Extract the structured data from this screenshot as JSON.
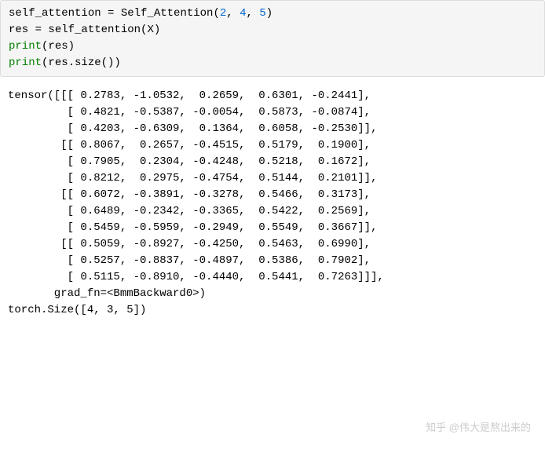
{
  "code": {
    "line1_parts": [
      {
        "c": "kw-black",
        "t": "self_attention "
      },
      {
        "c": "kw-black",
        "t": "= "
      },
      {
        "c": "kw-black",
        "t": "Self_Attention("
      },
      {
        "c": "num-blue",
        "t": "2"
      },
      {
        "c": "kw-black",
        "t": ", "
      },
      {
        "c": "num-blue",
        "t": "4"
      },
      {
        "c": "kw-black",
        "t": ", "
      },
      {
        "c": "num-blue",
        "t": "5"
      },
      {
        "c": "kw-black",
        "t": ")"
      }
    ],
    "line2_parts": [
      {
        "c": "kw-black",
        "t": "res "
      },
      {
        "c": "kw-black",
        "t": "= "
      },
      {
        "c": "kw-black",
        "t": "self_attention(X)"
      }
    ],
    "line3_parts": [
      {
        "c": "kw-green",
        "t": "print"
      },
      {
        "c": "kw-black",
        "t": "(res)"
      }
    ],
    "line4_parts": [
      {
        "c": "kw-green",
        "t": "print"
      },
      {
        "c": "kw-black",
        "t": "(res.size())"
      }
    ]
  },
  "output": [
    "tensor([[[ 0.2783, -1.0532,  0.2659,  0.6301, -0.2441],",
    "         [ 0.4821, -0.5387, -0.0054,  0.5873, -0.0874],",
    "         [ 0.4203, -0.6309,  0.1364,  0.6058, -0.2530]],",
    "",
    "        [[ 0.8067,  0.2657, -0.4515,  0.5179,  0.1900],",
    "         [ 0.7905,  0.2304, -0.4248,  0.5218,  0.1672],",
    "         [ 0.8212,  0.2975, -0.4754,  0.5144,  0.2101]],",
    "",
    "        [[ 0.6072, -0.3891, -0.3278,  0.5466,  0.3173],",
    "         [ 0.6489, -0.2342, -0.3365,  0.5422,  0.2569],",
    "         [ 0.5459, -0.5959, -0.2949,  0.5549,  0.3667]],",
    "",
    "        [[ 0.5059, -0.8927, -0.4250,  0.5463,  0.6990],",
    "         [ 0.5257, -0.8837, -0.4897,  0.5386,  0.7902],",
    "         [ 0.5115, -0.8910, -0.4440,  0.5441,  0.7263]]],",
    "       grad_fn=<BmmBackward0>)",
    "torch.Size([4, 3, 5])"
  ],
  "watermark": "知乎 @伟大是熬出来的",
  "chart_data": {
    "type": "table",
    "title": "tensor output",
    "shape": [
      4,
      3,
      5
    ],
    "data": [
      [
        [
          0.2783,
          -1.0532,
          0.2659,
          0.6301,
          -0.2441
        ],
        [
          0.4821,
          -0.5387,
          -0.0054,
          0.5873,
          -0.0874
        ],
        [
          0.4203,
          -0.6309,
          0.1364,
          0.6058,
          -0.253
        ]
      ],
      [
        [
          0.8067,
          0.2657,
          -0.4515,
          0.5179,
          0.19
        ],
        [
          0.7905,
          0.2304,
          -0.4248,
          0.5218,
          0.1672
        ],
        [
          0.8212,
          0.2975,
          -0.4754,
          0.5144,
          0.2101
        ]
      ],
      [
        [
          0.6072,
          -0.3891,
          -0.3278,
          0.5466,
          0.3173
        ],
        [
          0.6489,
          -0.2342,
          -0.3365,
          0.5422,
          0.2569
        ],
        [
          0.5459,
          -0.5959,
          -0.2949,
          0.5549,
          0.3667
        ]
      ],
      [
        [
          0.5059,
          -0.8927,
          -0.425,
          0.5463,
          0.699
        ],
        [
          0.5257,
          -0.8837,
          -0.4897,
          0.5386,
          0.7902
        ],
        [
          0.5115,
          -0.891,
          -0.444,
          0.5441,
          0.7263
        ]
      ]
    ],
    "grad_fn": "BmmBackward0",
    "size": [
      4,
      3,
      5
    ]
  }
}
